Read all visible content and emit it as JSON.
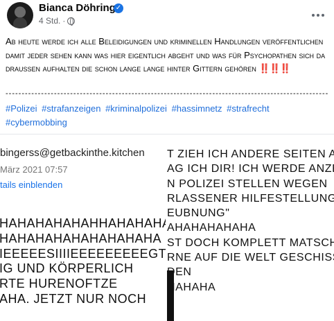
{
  "post": {
    "author": "Bianca Döhring",
    "verified_glyph": "✓",
    "time": "4 Std.",
    "separator": "·",
    "privacy_icon": "globe-icon",
    "more_icon": "more-options-icon",
    "text": "Ab heute werde ich alle Beleidigungen und kriminellen Handlungen veröffentlichen damit jeder sehen kann was hier eigentlich abgeht und was für Psychopathen sich da draußen aufhalten die schon lange lange hinter Gittern gehören",
    "emphasis": "‼️‼️‼️",
    "divider": "---------------------------------------------------------------------------------------------------------------------------",
    "hashtags": [
      "#Polizei",
      "#strafanzeigen",
      "#kriminalpolizei",
      "#hassimnetz",
      "#strafrecht",
      "#cybermobbing"
    ]
  },
  "image_left": {
    "email": "bingerss@getbackinthe.kitchen",
    "date": "März 2021 07:57",
    "details_link": "tails einblenden",
    "lines": [
      "HAHAHAHAHAHHAHAHAHA",
      "HAHAHAHAHAHAHAHAHA",
      "IEEEEESIIIIEEEEEEEEEGT A",
      "IG UND KÖRPERLICH",
      "RTE HURENOFTZE",
      "AHA. JETZT NUR NOCH"
    ]
  },
  "image_right": {
    "lines": [
      "T ZIEH ICH ANDERE SEITEN A",
      "AG ICH DIR! ICH WERDE ANZE",
      "N POLIZEI STELLEN WEGEN",
      "RLASSENER HILFESTELLUNG",
      "EUBNUNG\"",
      "AHAHAHAHAHA",
      "ST DOCH KOMPLETT MATSCH",
      "RNE AUF DIE WELT GESCHISS",
      "DEN",
      "HAHAHA"
    ]
  }
}
